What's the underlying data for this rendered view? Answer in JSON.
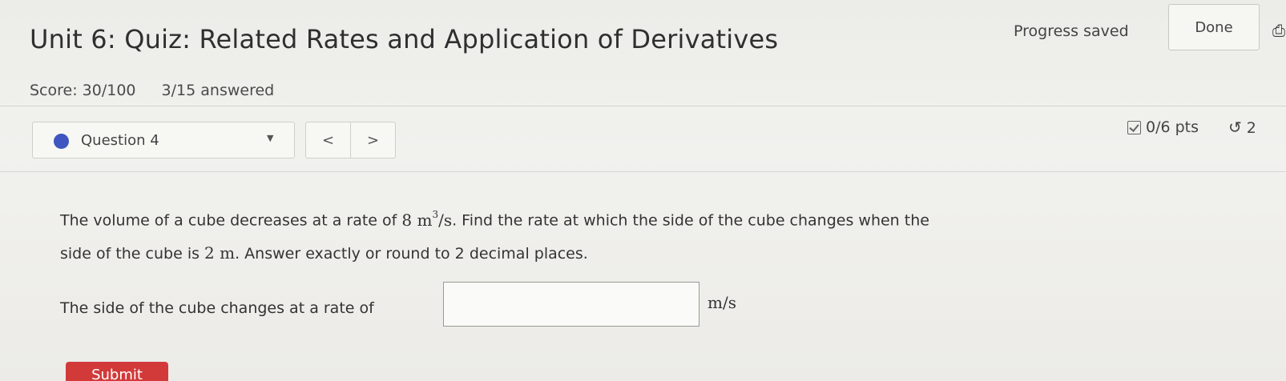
{
  "header": {
    "title": "Unit 6: Quiz: Related Rates and Application of Derivatives",
    "progress_status": "Progress saved",
    "done_label": "Done",
    "corner_icon": "print-icon"
  },
  "score": {
    "score_text": "Score: 30/100",
    "answered_text": "3/15 answered"
  },
  "question_nav": {
    "selected_question": "Question 4",
    "prev_label": "<",
    "next_label": ">",
    "points": "0/6 pts",
    "retries": "2"
  },
  "question": {
    "part1": "The volume of a cube decreases at a rate of ",
    "rate_value": "8",
    "rate_unit_base": "m",
    "rate_unit_exp": "3",
    "rate_unit_tail": "/s",
    "part2": ". Find the rate at which the side of the cube changes when the side of the cube is ",
    "side_value": "2 m",
    "part3": ". Answer exactly or round to 2 decimal places."
  },
  "answer": {
    "label": "The side of the cube changes at a rate of",
    "value": "",
    "unit": "m/s"
  },
  "submit_label": "Submit",
  "colors": {
    "accent_blue": "#3f55c0",
    "submit_red": "#d23a3a"
  }
}
